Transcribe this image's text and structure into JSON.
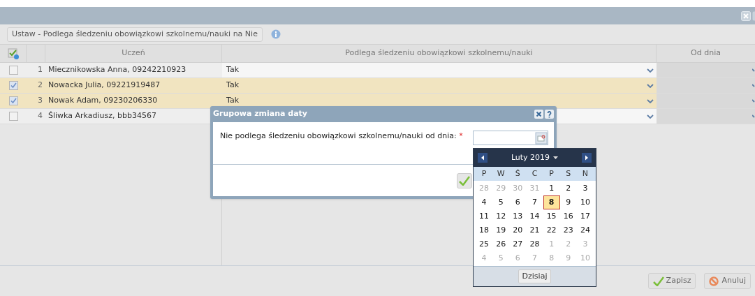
{
  "toolbar": {
    "button": "Ustaw - Podlega śledzeniu obowiązkowi szkolnemu/nauki na Nie"
  },
  "table": {
    "columns": [
      "Uczeń",
      "Podlega śledzeniu obowiązkowi szkolnemu/nauki",
      "Od dnia"
    ],
    "rows": [
      {
        "checked": false,
        "number": "1",
        "student": "Miecznikowska Anna, 09242210923",
        "value": "Tak"
      },
      {
        "checked": true,
        "number": "2",
        "student": "Nowacka Julia, 09221919487",
        "value": "Tak"
      },
      {
        "checked": true,
        "number": "3",
        "student": "Nowak Adam, 09230206330",
        "value": "Tak"
      },
      {
        "checked": false,
        "number": "4",
        "student": "Śliwka Arkadiusz, bbb34567",
        "value": ""
      }
    ]
  },
  "buttons": [
    "Zapisz",
    "Anuluj"
  ],
  "dialog": {
    "title": "Grupowa zmiana daty",
    "label": "Nie podlega śledzeniu obowiązkowi szkolnemu/nauki od dnia:",
    "required": "*"
  },
  "calendar": {
    "month": "Luty 2019",
    "weekdays": [
      "P",
      "W",
      "Ś",
      "C",
      "P",
      "S",
      "N"
    ],
    "days": [
      {
        "d": "28",
        "muted": true,
        "selected": false
      },
      {
        "d": "29",
        "muted": true,
        "selected": false
      },
      {
        "d": "30",
        "muted": true,
        "selected": false
      },
      {
        "d": "31",
        "muted": true,
        "selected": false
      },
      {
        "d": "1",
        "muted": false,
        "selected": false
      },
      {
        "d": "2",
        "muted": false,
        "selected": false
      },
      {
        "d": "3",
        "muted": false,
        "selected": false
      },
      {
        "d": "4",
        "muted": false,
        "selected": false
      },
      {
        "d": "5",
        "muted": false,
        "selected": false
      },
      {
        "d": "6",
        "muted": false,
        "selected": false
      },
      {
        "d": "7",
        "muted": false,
        "selected": false
      },
      {
        "d": "8",
        "muted": false,
        "selected": true
      },
      {
        "d": "9",
        "muted": false,
        "selected": false
      },
      {
        "d": "10",
        "muted": false,
        "selected": false
      },
      {
        "d": "11",
        "muted": false,
        "selected": false
      },
      {
        "d": "12",
        "muted": false,
        "selected": false
      },
      {
        "d": "13",
        "muted": false,
        "selected": false
      },
      {
        "d": "14",
        "muted": false,
        "selected": false
      },
      {
        "d": "15",
        "muted": false,
        "selected": false
      },
      {
        "d": "16",
        "muted": false,
        "selected": false
      },
      {
        "d": "17",
        "muted": false,
        "selected": false
      },
      {
        "d": "18",
        "muted": false,
        "selected": false
      },
      {
        "d": "19",
        "muted": false,
        "selected": false
      },
      {
        "d": "20",
        "muted": false,
        "selected": false
      },
      {
        "d": "21",
        "muted": false,
        "selected": false
      },
      {
        "d": "22",
        "muted": false,
        "selected": false
      },
      {
        "d": "23",
        "muted": false,
        "selected": false
      },
      {
        "d": "24",
        "muted": false,
        "selected": false
      },
      {
        "d": "25",
        "muted": false,
        "selected": false
      },
      {
        "d": "26",
        "muted": false,
        "selected": false
      },
      {
        "d": "27",
        "muted": false,
        "selected": false
      },
      {
        "d": "28",
        "muted": false,
        "selected": false
      },
      {
        "d": "1",
        "muted": true,
        "selected": false
      },
      {
        "d": "2",
        "muted": true,
        "selected": false
      },
      {
        "d": "3",
        "muted": true,
        "selected": false
      },
      {
        "d": "4",
        "muted": true,
        "selected": false
      },
      {
        "d": "5",
        "muted": true,
        "selected": false
      },
      {
        "d": "6",
        "muted": true,
        "selected": false
      },
      {
        "d": "7",
        "muted": true,
        "selected": false
      },
      {
        "d": "8",
        "muted": true,
        "selected": false
      },
      {
        "d": "9",
        "muted": true,
        "selected": false
      },
      {
        "d": "10",
        "muted": true,
        "selected": false
      }
    ],
    "today": "Dzisiaj"
  }
}
